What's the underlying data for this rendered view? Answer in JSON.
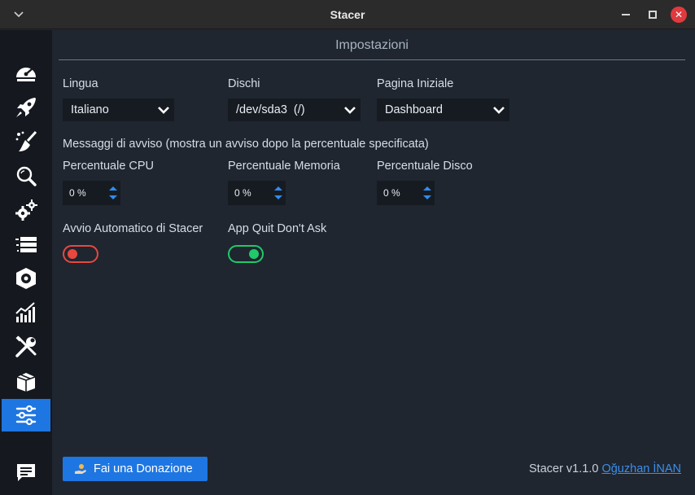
{
  "window": {
    "title": "Stacer"
  },
  "sidebar": {
    "items": [
      {
        "name": "dashboard-icon"
      },
      {
        "name": "startup-apps-icon"
      },
      {
        "name": "system-cleaner-icon"
      },
      {
        "name": "search-icon"
      },
      {
        "name": "services-icon"
      },
      {
        "name": "processes-icon"
      },
      {
        "name": "uninstaller-icon"
      },
      {
        "name": "resources-icon"
      },
      {
        "name": "helpers-icon"
      },
      {
        "name": "apt-repository-icon"
      },
      {
        "name": "settings-icon",
        "active": true
      },
      {
        "name": "feedback-icon"
      }
    ]
  },
  "main": {
    "title": "Impostazioni",
    "language": {
      "label": "Lingua",
      "value": "Italiano"
    },
    "disks": {
      "label": "Dischi",
      "value": "/dev/sda3  (/)"
    },
    "homepage": {
      "label": "Pagina Iniziale",
      "value": "Dashboard"
    },
    "alerts_heading": "Messaggi di avviso (mostra un avviso dopo la percentuale specificata)",
    "cpu": {
      "label": "Percentuale CPU",
      "value": "0 %"
    },
    "memory": {
      "label": "Percentuale Memoria",
      "value": "0 %"
    },
    "disk": {
      "label": "Percentuale Disco",
      "value": "0 %"
    },
    "autostart": {
      "label": "Avvio Automatico di Stacer",
      "enabled": false
    },
    "quit_dont_ask": {
      "label": "App Quit Don't Ask",
      "enabled": true
    },
    "donate_label": "Fai una Donazione",
    "version_text": "Stacer v1.1.0",
    "author_link": "Oğuzhan İNAN"
  },
  "colors": {
    "accent": "#1e76e2",
    "toggle_off": "#e8483f",
    "toggle_on": "#20c96a",
    "link": "#3d8ee8"
  }
}
